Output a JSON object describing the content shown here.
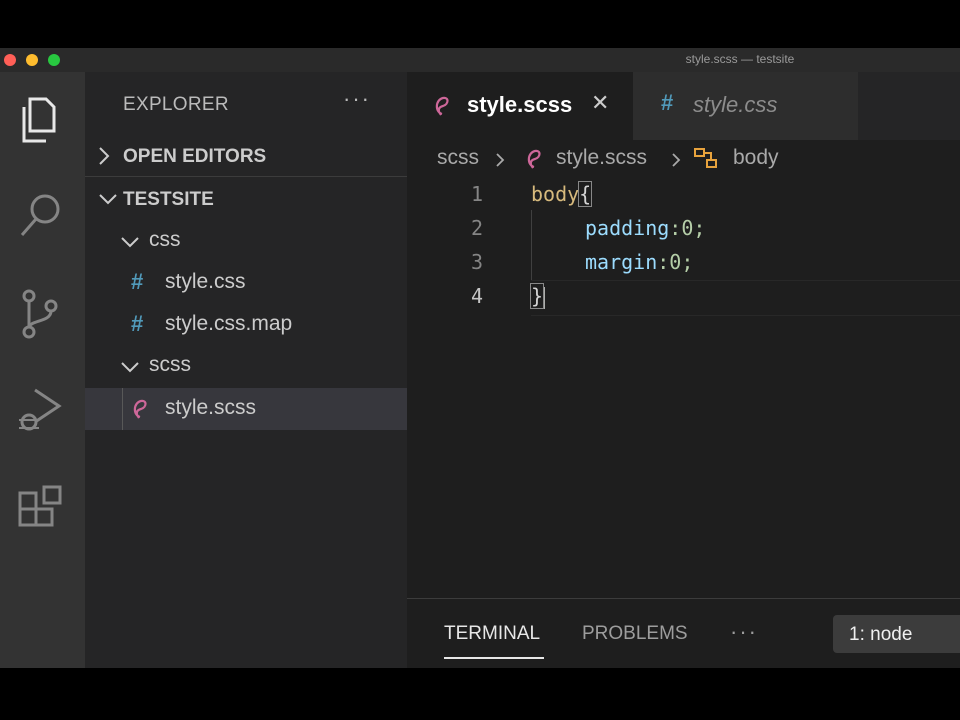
{
  "window": {
    "title": "style.scss — testsite"
  },
  "activity_bar": {
    "icons": [
      "explorer-icon",
      "search-icon",
      "source-control-icon",
      "run-debug-icon",
      "extensions-icon"
    ]
  },
  "sidebar": {
    "title": "EXPLORER",
    "more": "···",
    "open_editors": "OPEN EDITORS",
    "folder": "TESTSITE",
    "tree": [
      {
        "label": "css",
        "type": "folder"
      },
      {
        "label": "style.css",
        "type": "css-file"
      },
      {
        "label": "style.css.map",
        "type": "css-file"
      },
      {
        "label": "scss",
        "type": "folder"
      },
      {
        "label": "style.scss",
        "type": "scss-file",
        "selected": true
      }
    ],
    "file_hash": "#"
  },
  "tabs": [
    {
      "label": "style.scss",
      "active": true,
      "close": "✕"
    },
    {
      "label": "style.css",
      "active": false,
      "icon": "#"
    }
  ],
  "breadcrumbs": [
    "scss",
    "style.scss",
    "body"
  ],
  "editor": {
    "line_numbers": [
      "1",
      "2",
      "3",
      "4"
    ],
    "lines": {
      "l1_selector": "body",
      "l1_brace": "{",
      "l2_prop": "padding",
      "l2_val": ":0;",
      "l3_prop": "margin",
      "l3_val": ":0;",
      "l4_brace": "}"
    }
  },
  "panel": {
    "tabs": [
      "TERMINAL",
      "PROBLEMS"
    ],
    "more": "···",
    "terminal_select": "1: node"
  },
  "colors": {
    "accent_scss": "#cd6799",
    "css_hash": "#519aba",
    "selector": "#d7ba7d",
    "property": "#9cdcfe",
    "number": "#b5cea8"
  }
}
